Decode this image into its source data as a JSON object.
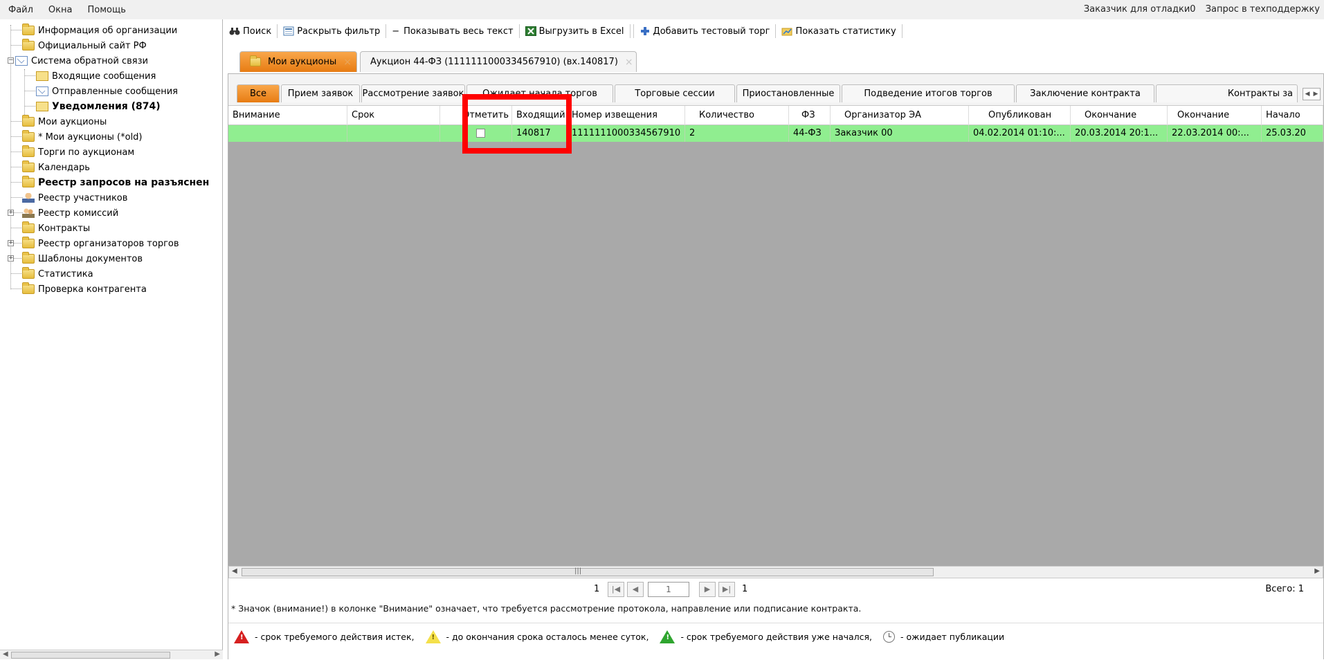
{
  "menu": {
    "items": [
      "Файл",
      "Окна",
      "Помощь"
    ],
    "right": [
      "Заказчик для отладки0",
      "Запрос в техподдержку"
    ]
  },
  "tree": {
    "items": [
      {
        "label": "Информация об организации",
        "icon": "folder-icon"
      },
      {
        "label": "Официальный сайт РФ",
        "icon": "folder-icon"
      },
      {
        "label": "Система обратной связи",
        "icon": "envelope-icon"
      },
      {
        "label": "Входящие сообщения",
        "icon": "open-envelope-icon"
      },
      {
        "label": "Отправленные сообщения",
        "icon": "sent-envelope-icon"
      },
      {
        "label": "Уведомления (874)",
        "icon": "open-envelope-icon"
      },
      {
        "label": "Мои аукционы",
        "icon": "folder-icon"
      },
      {
        "label": "* Мои аукционы (*old)",
        "icon": "folder-icon"
      },
      {
        "label": "Торги по аукционам",
        "icon": "folder-icon"
      },
      {
        "label": "Календарь",
        "icon": "folder-icon"
      },
      {
        "label": "Реестр запросов на разъяснен",
        "icon": "folder-icon"
      },
      {
        "label": "Реестр участников",
        "icon": "person-icon"
      },
      {
        "label": "Реестр комиссий",
        "icon": "people-icon"
      },
      {
        "label": "Контракты",
        "icon": "folder-icon"
      },
      {
        "label": "Реестр организаторов торгов",
        "icon": "folder-icon"
      },
      {
        "label": "Шаблоны документов",
        "icon": "folder-icon"
      },
      {
        "label": "Статистика",
        "icon": "folder-icon"
      },
      {
        "label": "Проверка контрагента",
        "icon": "folder-icon"
      }
    ]
  },
  "toolbar": {
    "search": "Поиск",
    "expand_filter": "Раскрыть фильтр",
    "show_all_text": "Показывать весь текст",
    "export_excel": "Выгрузить в Excel",
    "add_test": "Добавить тестовый торг",
    "show_stats": "Показать статистику"
  },
  "doc_tabs": [
    "Мои аукционы",
    "Аукцион 44-ФЗ (1111111000334567910) (вх.140817)"
  ],
  "status_tabs": [
    "Все",
    "Прием заявок",
    "Рассмотрение заявок",
    "Ожидает начала торгов",
    "Торговые сессии",
    "Приостановленные",
    "Подведение итогов торгов",
    "Заключение контракта",
    "Контракты за"
  ],
  "grid": {
    "columns": [
      "Внимание",
      "Срок",
      "Отметить",
      "Входящий",
      "Номер извещения",
      "Количество",
      "ФЗ",
      "Организатор ЭА",
      "Опубликован",
      "Окончание",
      "Окончание",
      "Начало"
    ],
    "rows": [
      {
        "attention": "",
        "deadline": "",
        "marked": false,
        "incoming": "140817",
        "notice_number": "1111111000334567910",
        "quantity": "2",
        "law": "44-ФЗ",
        "organizer": "Заказчик 00",
        "published": "04.02.2014 01:10:...",
        "end1": "20.03.2014 20:1...",
        "end2": "22.03.2014 00:...",
        "start": "25.03.20"
      }
    ],
    "row_color": "#90ee90",
    "highlight_color": "#ff0000"
  },
  "pager": {
    "page_left": "1",
    "current": "1",
    "page_right": "1",
    "total": "Всего: 1"
  },
  "note": "* Значок (внимание!) в колонке \"Внимание\" означает, что требуется рассмотрение протокола, направление или подписание контракта.",
  "legend": [
    {
      "icon": "red-warning-icon",
      "text": "- срок требуемого действия истек,"
    },
    {
      "icon": "yellow-warning-icon",
      "text": "- до окончания срока осталось менее суток,"
    },
    {
      "icon": "green-warning-icon",
      "text": "- срок требуемого действия уже начался,"
    },
    {
      "icon": "clock-icon",
      "text": "- ожидает публикации"
    }
  ]
}
